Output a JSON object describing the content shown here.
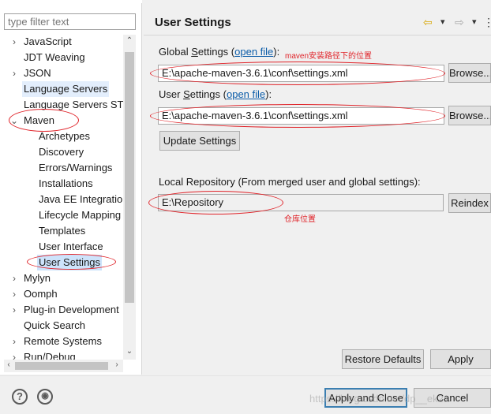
{
  "filter": {
    "placeholder": "type filter text"
  },
  "tree": {
    "items": [
      {
        "label": "JavaScript",
        "twisty": "›"
      },
      {
        "label": "JDT Weaving",
        "twisty": ""
      },
      {
        "label": "JSON",
        "twisty": "›"
      },
      {
        "label": "Language Servers",
        "twisty": ""
      },
      {
        "label": "Language Servers STS",
        "twisty": ""
      },
      {
        "label": "Maven",
        "twisty": "⌄"
      },
      {
        "label": "Archetypes"
      },
      {
        "label": "Discovery"
      },
      {
        "label": "Errors/Warnings"
      },
      {
        "label": "Installations"
      },
      {
        "label": "Java EE Integration"
      },
      {
        "label": "Lifecycle Mapping"
      },
      {
        "label": "Templates"
      },
      {
        "label": "User Interface"
      },
      {
        "label": "User Settings"
      },
      {
        "label": "Mylyn",
        "twisty": "›"
      },
      {
        "label": "Oomph",
        "twisty": "›"
      },
      {
        "label": "Plug-in Development",
        "twisty": "›"
      },
      {
        "label": "Quick Search",
        "twisty": ""
      },
      {
        "label": "Remote Systems",
        "twisty": "›"
      },
      {
        "label": "Run/Debug",
        "twisty": "›"
      }
    ]
  },
  "page": {
    "title": "User Settings",
    "nav": {
      "back": "⇦",
      "back_menu": "▾",
      "forward": "⇨",
      "forward_menu": "▾",
      "view_menu": "⋮"
    }
  },
  "global": {
    "label_prefix": "Global ",
    "label_s": "S",
    "label_rest": "ettings (",
    "open_file": "open file",
    "label_suffix": "):",
    "path": "E:\\apache-maven-3.6.1\\conf\\settings.xml",
    "browse": "Browse...",
    "note": "maven安装路径下的位置"
  },
  "user": {
    "label_prefix": "User ",
    "label_s": "S",
    "label_rest": "ettings (",
    "open_file": "open file",
    "label_suffix": "):",
    "path": "E:\\apache-maven-3.6.1\\conf\\settings.xml",
    "browse": "Browse...",
    "update": "Update Settings"
  },
  "local": {
    "label": "Local Repository (From merged user and global settings):",
    "path": "E:\\Repository",
    "reindex": "Reindex",
    "note": "仓库位置"
  },
  "actions": {
    "restore_defaults": "Restore Defaults",
    "apply": "Apply",
    "apply_close": "Apply and Close",
    "cancel": "Cancel"
  },
  "bottom": {
    "help": "?",
    "import": "◉"
  },
  "watermark": "https://blog.csdn.net/dp__ek21",
  "colors": {
    "annotation": "#e0242a",
    "link": "#0b5ca8",
    "selection": "#cde3fb"
  }
}
